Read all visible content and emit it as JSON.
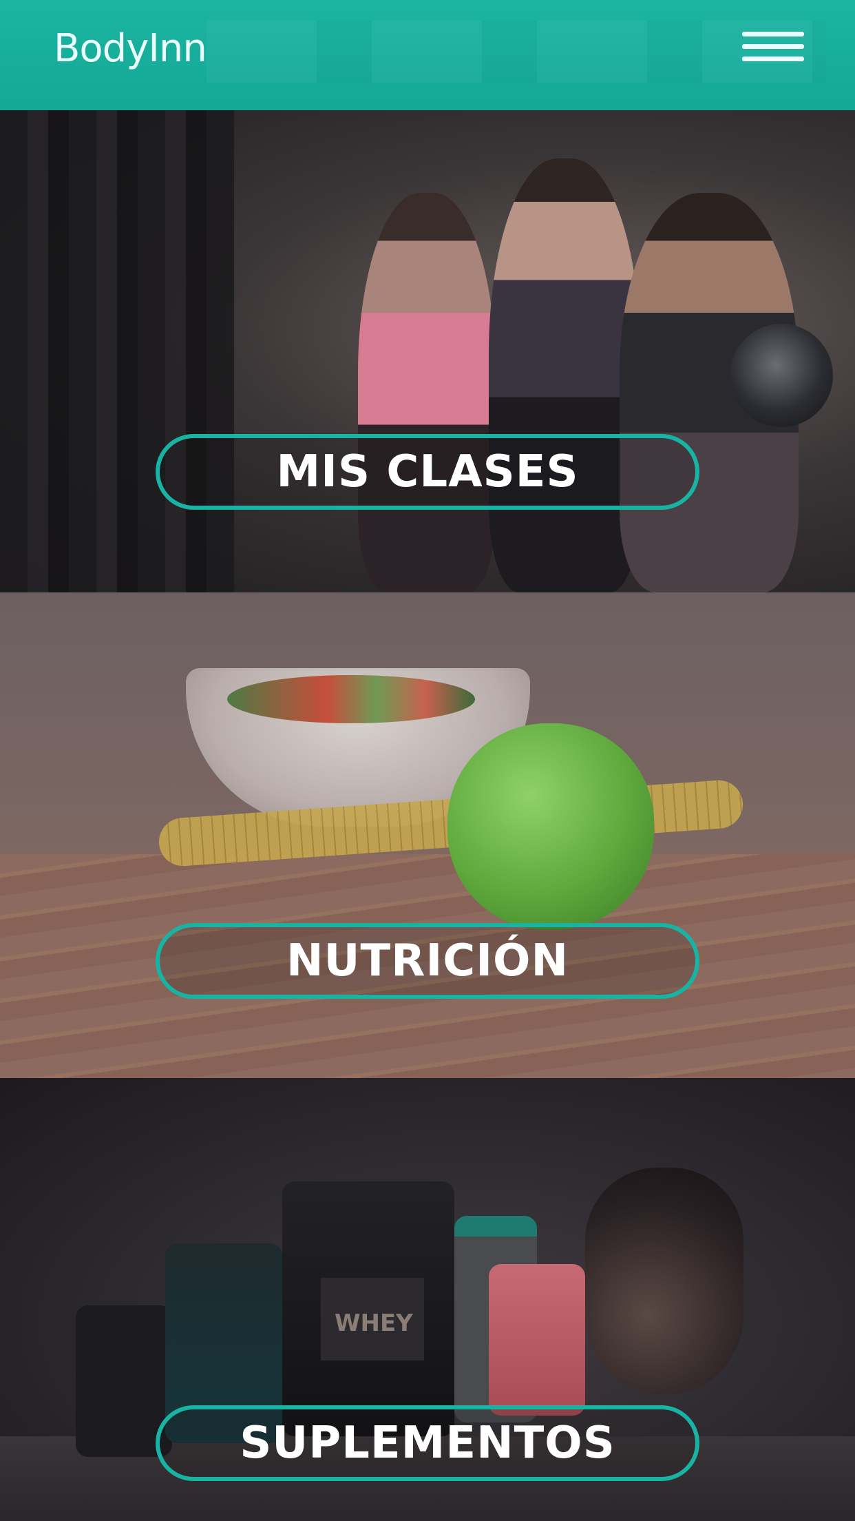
{
  "header": {
    "logo_text": "BodyInn",
    "menu_icon": "hamburger-menu-icon",
    "background_color": "#14a896"
  },
  "sections": [
    {
      "label": "MIS CLASES"
    },
    {
      "label": "NUTRICIÓN"
    },
    {
      "label": "SUPLEMENTOS"
    }
  ],
  "theme": {
    "accent": "#18b3a2",
    "button_text_color": "#ffffff"
  },
  "images": {
    "jar_label": "WHEY"
  }
}
